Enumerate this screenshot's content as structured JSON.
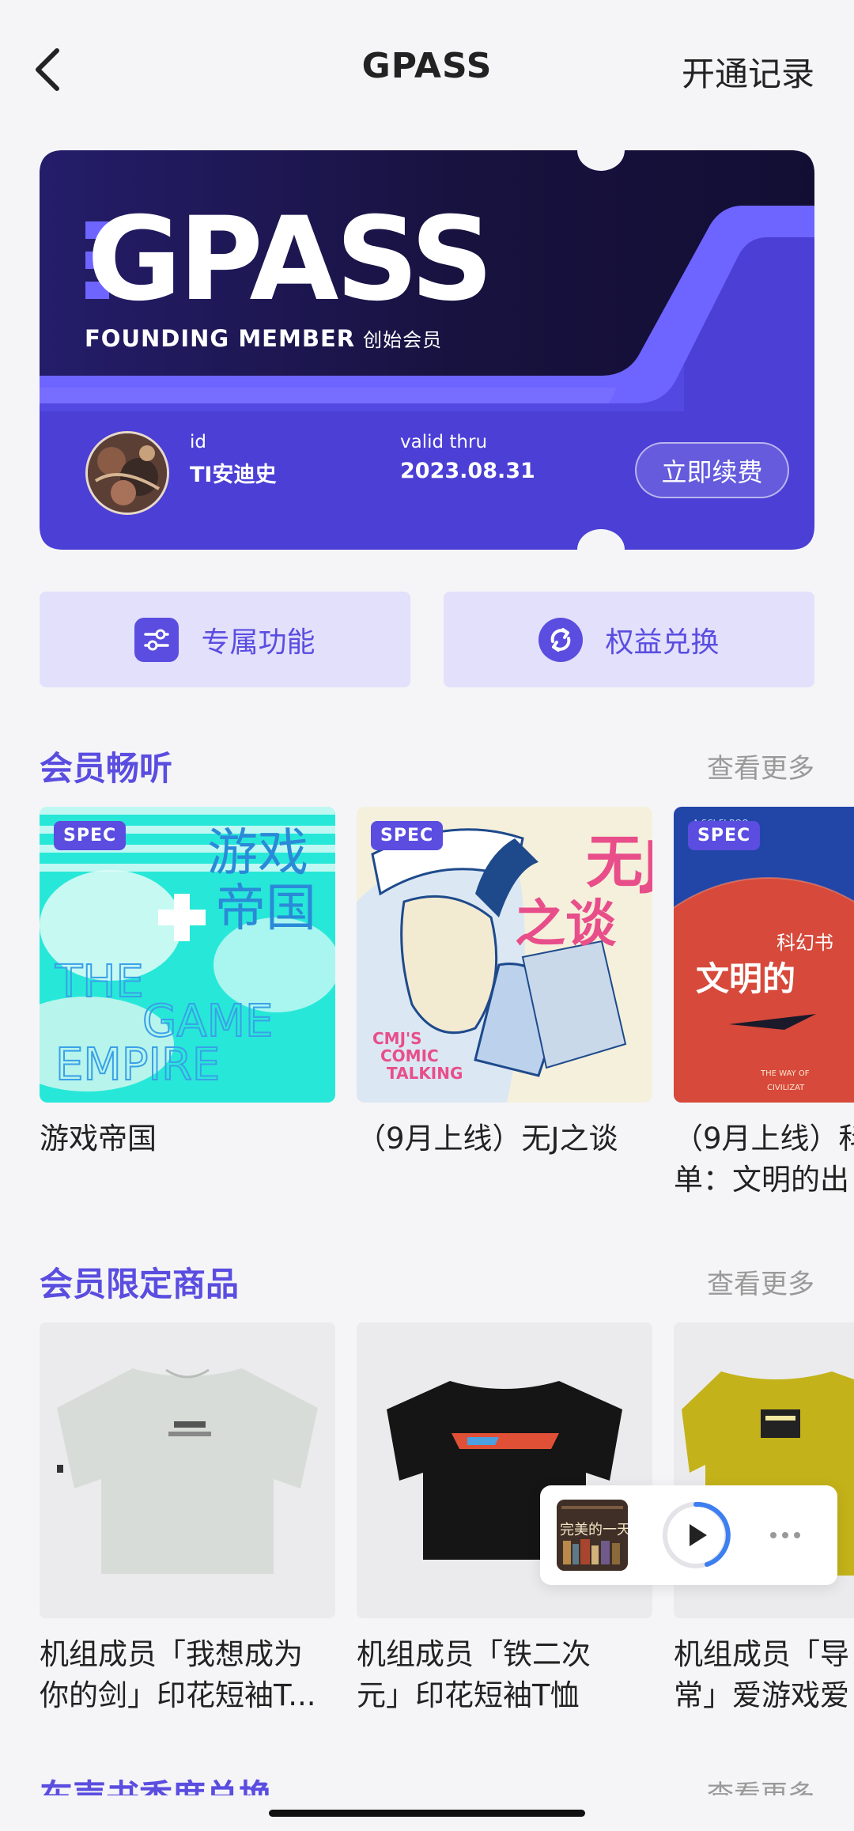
{
  "header": {
    "title": "GPASS",
    "records": "开通记录"
  },
  "card": {
    "brand": "GPASS",
    "subtitle_en": "FOUNDING MEMBER",
    "subtitle_cn": "创始会员",
    "id_label": "id",
    "id_value": "TI安迪史",
    "valid_label": "valid thru",
    "valid_value": "2023.08.31",
    "renew": "立即续费",
    "colors": {
      "dark": "#1b1548",
      "purple": "#4b3fd6",
      "accent": "#6e64ff"
    }
  },
  "features": [
    {
      "label": "专属功能",
      "icon": "sliders-icon"
    },
    {
      "label": "权益兑换",
      "icon": "exchange-icon"
    }
  ],
  "listen": {
    "title": "会员畅听",
    "more": "查看更多",
    "items": [
      {
        "badge": "SPEC",
        "cover_title": "游戏\n帝国",
        "cover_sub": "THE GAME EMPIRE",
        "caption1": "游戏帝国",
        "caption2": ""
      },
      {
        "badge": "SPEC",
        "cover_title": "无J之谈",
        "cover_sub": "CMJ'S COMIC TALKING",
        "caption1": "（9月上线）无J之谈",
        "caption2": ""
      },
      {
        "badge": "SPEC",
        "cover_title": "科幻书 文明的",
        "cover_sub": "A SCI-FI BOOK",
        "caption1": "（9月上线）科",
        "caption2": "单：文明的出"
      }
    ]
  },
  "goods": {
    "title": "会员限定商品",
    "more": "查看更多",
    "items": [
      {
        "caption1": "机组成员「我想成为",
        "caption2": "你的剑」印花短袖T..."
      },
      {
        "caption1": "机组成员「铁二次",
        "caption2": "元」印花短袖T恤"
      },
      {
        "caption1": "机组成员「导",
        "caption2": "常」爱游戏爱"
      }
    ]
  },
  "next_section": {
    "title": "车声书香度总换",
    "more": "查看更多"
  },
  "player": {
    "thumb_text": "完美的一天"
  }
}
